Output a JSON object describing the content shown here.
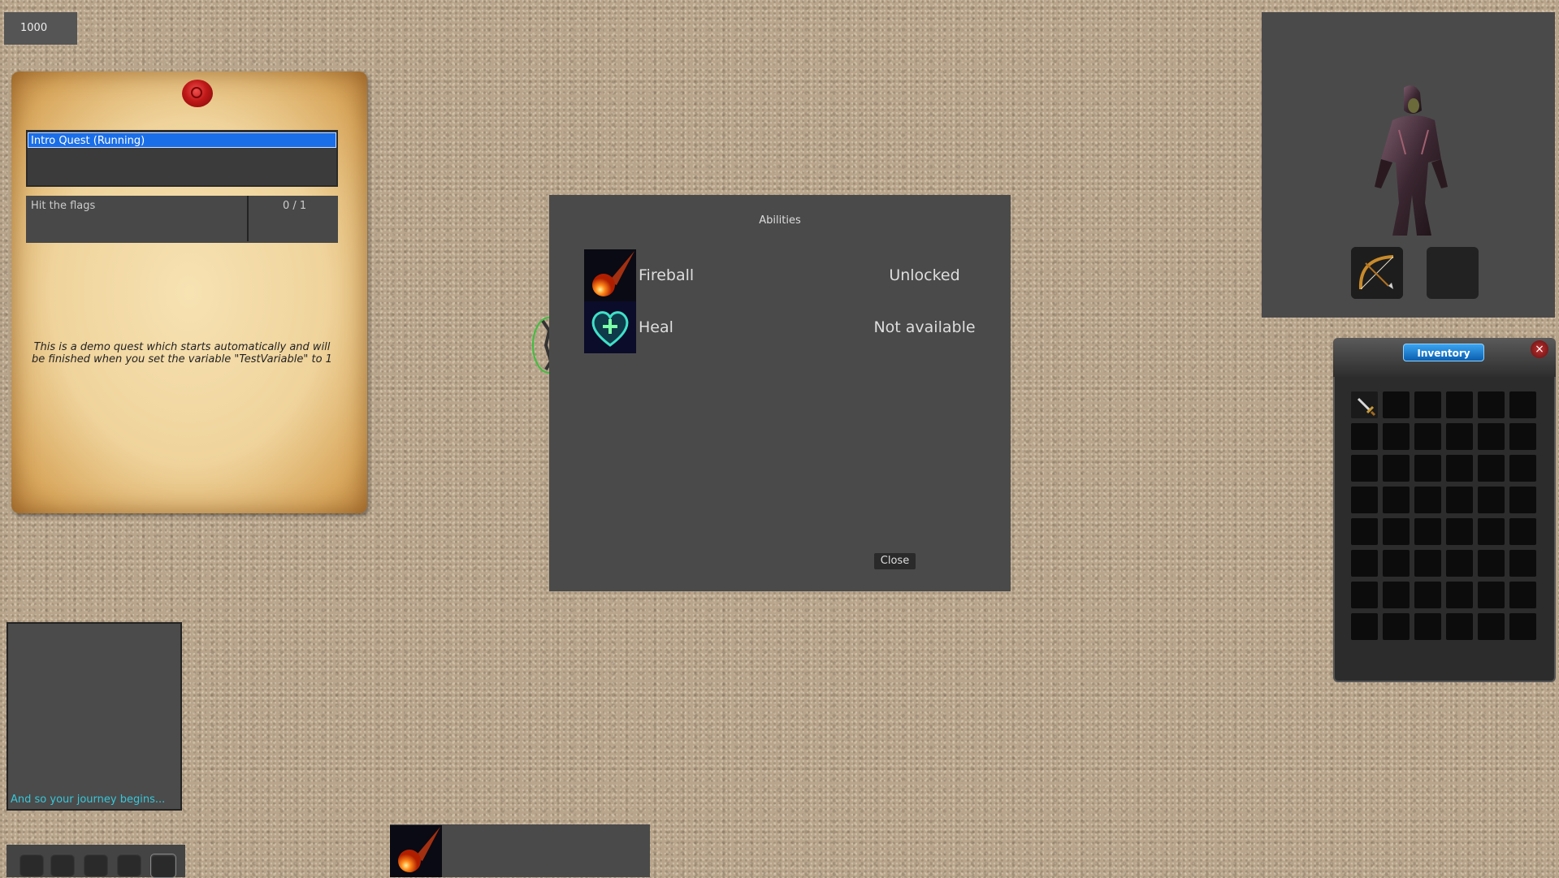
{
  "hud": {
    "currency": "1000"
  },
  "quest_log": {
    "quests": [
      {
        "label": "Intro Quest (Running)"
      }
    ],
    "objectives": [
      {
        "text": "Hit the flags",
        "progress": "0 / 1"
      }
    ],
    "description": "This is a demo quest which starts automatically and will be finished when you set the variable \"TestVariable\" to 1"
  },
  "chat": {
    "lines": [
      "And so your journey begins..."
    ]
  },
  "abilities_dialog": {
    "title": "Abilities",
    "abilities": [
      {
        "name": "Fireball",
        "status": "Unlocked",
        "icon": "fireball-icon"
      },
      {
        "name": "Heal",
        "status": "Not available",
        "icon": "heal-icon"
      }
    ],
    "close_label": "Close"
  },
  "skill_bar": {
    "slots": [
      {
        "icon": "fireball-icon"
      }
    ]
  },
  "character": {
    "equipment": [
      {
        "icon": "bow-icon"
      },
      {
        "icon": "empty-slot"
      }
    ]
  },
  "inventory": {
    "title": "Inventory",
    "rows": 8,
    "cols": 6,
    "items": [
      {
        "icon": "dagger-icon",
        "slot": 0
      }
    ]
  },
  "colors": {
    "quest_selected": "#1a6ee8",
    "chat_text": "#38c6d8",
    "panel": "#4a4a4a",
    "inventory_title": "#1f86d8"
  }
}
